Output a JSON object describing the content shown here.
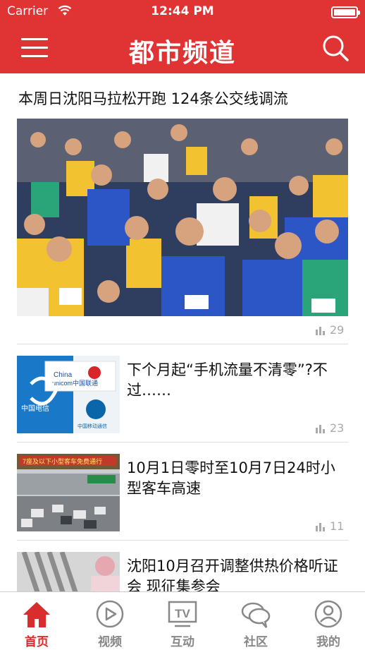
{
  "status_bar": {
    "carrier": "Carrier",
    "time": "12:44 PM"
  },
  "header": {
    "title": "都市频道"
  },
  "feature": {
    "headline": "本周日沈阳马拉松开跑 124条公交线调流",
    "views": "29"
  },
  "articles": [
    {
      "title": "下个月起“手机流量不清零”?不过……",
      "views": "23"
    },
    {
      "title": "10月1日零时至10月7日24时小型客车高速",
      "views": "11"
    },
    {
      "title": "沈阳10月召开调整供热价格听证会 现征集参会",
      "views": ""
    }
  ],
  "tabs": [
    {
      "label": "首页",
      "icon": "home-icon",
      "active": true
    },
    {
      "label": "视频",
      "icon": "play-icon"
    },
    {
      "label": "互动",
      "icon": "tv-icon"
    },
    {
      "label": "社区",
      "icon": "chat-icon"
    },
    {
      "label": "我的",
      "icon": "user-icon"
    }
  ],
  "colors": {
    "brand": "#e03434",
    "tab_active": "#d92c2c",
    "tab_inactive": "#888888"
  }
}
